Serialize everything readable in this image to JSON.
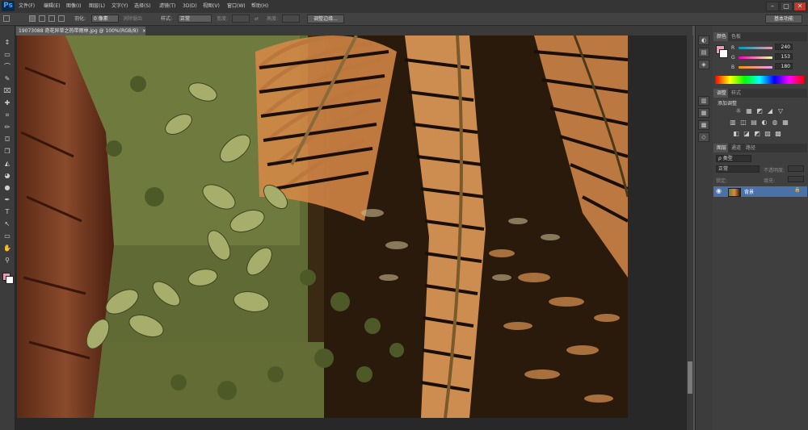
{
  "menubar": {
    "logo": "Ps",
    "items": [
      "文件(F)",
      "编辑(E)",
      "图像(I)",
      "图层(L)",
      "文字(Y)",
      "选择(S)",
      "滤镜(T)",
      "3D(D)",
      "视图(V)",
      "窗口(W)",
      "帮助(H)"
    ],
    "window_controls": [
      "–",
      "▢",
      "✕"
    ]
  },
  "optbar": {
    "feather_label": "羽化:",
    "feather_value": "0 像素",
    "antialias_label": "消除锯齿",
    "style_label": "样式:",
    "style_value": "正常",
    "width_label": "宽度:",
    "height_label": "高度:",
    "refine_edge_button": "调整边缘...",
    "workspace_button": "基本功能"
  },
  "document": {
    "tab_title": "19073088 奇花异草之热带雨林.jpg @ 100%(RGB/8)",
    "close": "×"
  },
  "color_panel": {
    "tabs": [
      "颜色",
      "色板"
    ],
    "channels": [
      {
        "label": "R",
        "value": "240",
        "ratio": 0.94
      },
      {
        "label": "G",
        "value": "153",
        "ratio": 0.6
      },
      {
        "label": "B",
        "value": "180",
        "ratio": 0.7
      }
    ],
    "foreground_color": "#f099b4",
    "background_color": "#ffffff"
  },
  "adjust_panel": {
    "tabs": [
      "调整",
      "样式"
    ],
    "title": "添加调整",
    "row1": [
      "☼",
      "▦",
      "◩",
      "◢",
      "▽"
    ],
    "row2": [
      "▥",
      "◫",
      "▤",
      "◐",
      "◍",
      "▦"
    ],
    "row3": [
      "◧",
      "◪",
      "◩",
      "▨",
      "▩"
    ]
  },
  "layers_panel": {
    "tabs": [
      "图层",
      "通道",
      "路径"
    ],
    "filter_value": "ρ 类型",
    "blend_mode": "正常",
    "opacity_label": "不透明度:",
    "lock_label": "锁定:",
    "fill_label": "填充:",
    "layer_name": "背景",
    "eye_icon": "◉",
    "lock_icon": "🔒"
  },
  "tools": [
    "↕",
    "▭",
    "⌒",
    "✎",
    "⌧",
    "✚",
    "⌗",
    "✏",
    "⛋",
    "❐",
    "◭",
    "◕",
    "●",
    "✒",
    "T",
    "↖",
    "▭",
    "✋",
    "⚲"
  ],
  "dock_icons": [
    "◐",
    "▤",
    "◈",
    "▥",
    "▦",
    "▩",
    "◇"
  ]
}
